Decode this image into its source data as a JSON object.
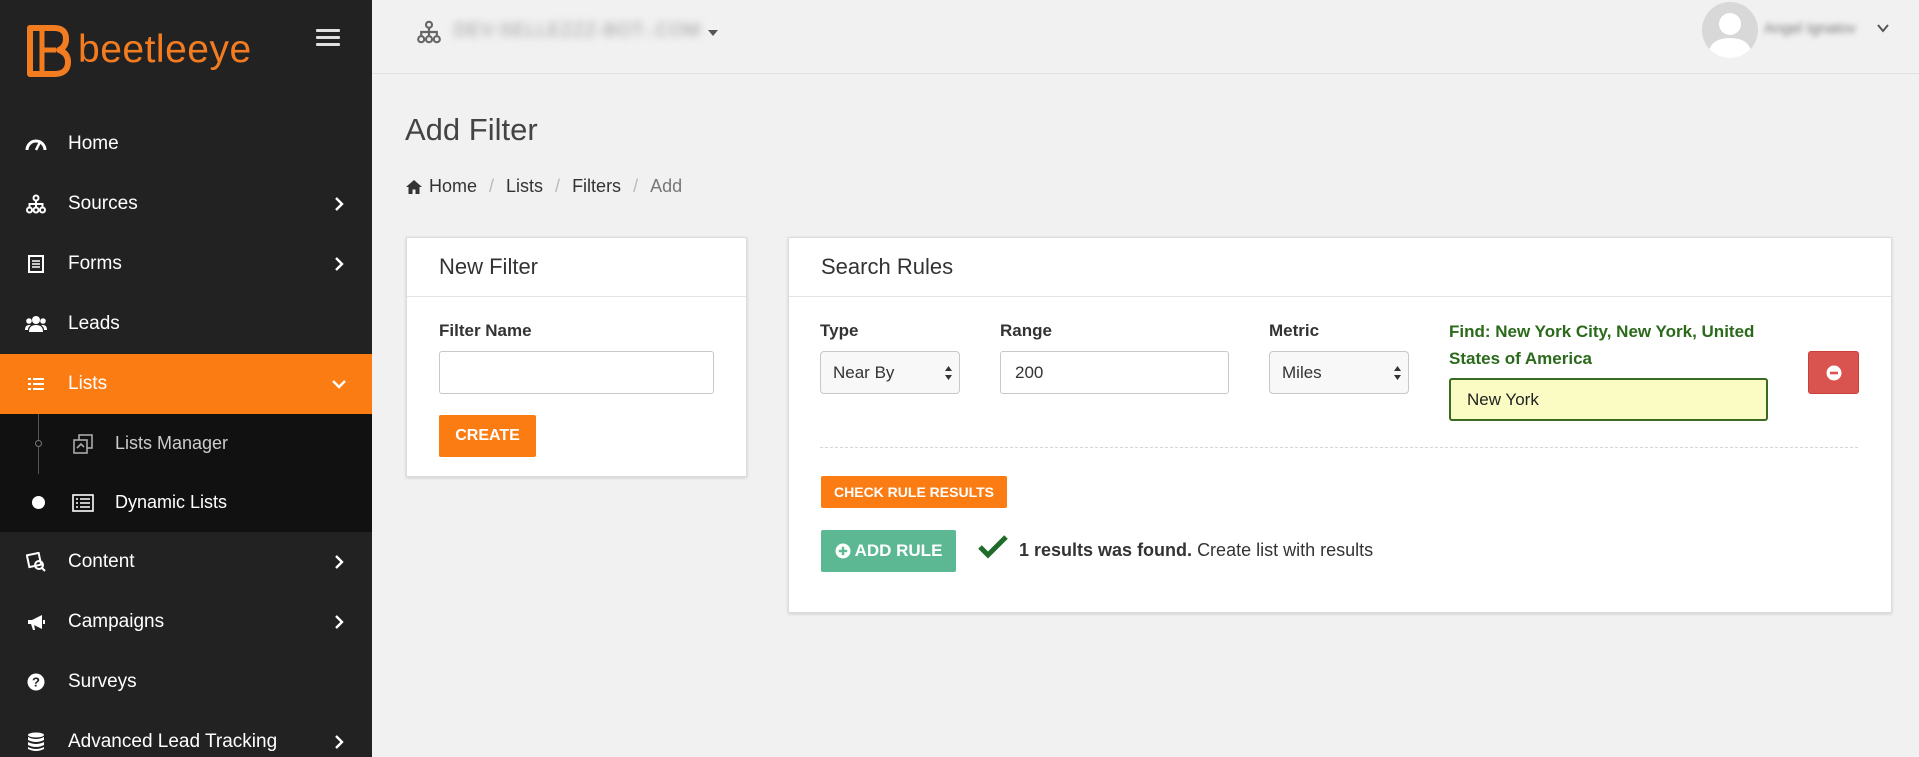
{
  "brand": {
    "name": "beetleeye",
    "color": "#f47c20"
  },
  "sidebar": {
    "items": [
      {
        "label": "Home",
        "icon": "gauge-icon",
        "has_arrow": false
      },
      {
        "label": "Sources",
        "icon": "sitemap-icon",
        "has_arrow": true
      },
      {
        "label": "Forms",
        "icon": "form-icon",
        "has_arrow": true
      },
      {
        "label": "Leads",
        "icon": "users-icon",
        "has_arrow": false
      },
      {
        "label": "Lists",
        "icon": "list-icon",
        "has_arrow": true,
        "active": true
      },
      {
        "label": "Content",
        "icon": "content-icon",
        "has_arrow": true
      },
      {
        "label": "Campaigns",
        "icon": "megaphone-icon",
        "has_arrow": true
      },
      {
        "label": "Surveys",
        "icon": "question-circle-icon",
        "has_arrow": false
      },
      {
        "label": "Advanced Lead Tracking",
        "icon": "database-icon",
        "has_arrow": true
      }
    ],
    "sub_items": [
      {
        "label": "Lists Manager",
        "icon": "copy-icon",
        "active": false
      },
      {
        "label": "Dynamic Lists",
        "icon": "list-alt-icon",
        "active": true
      }
    ]
  },
  "topbar": {
    "org_name": "DEV-SELLEZZZ-BOT-.COM",
    "user_name": "Angel Ignatov"
  },
  "page": {
    "title": "Add Filter",
    "breadcrumb": [
      "Home",
      "Lists",
      "Filters",
      "Add"
    ]
  },
  "new_filter": {
    "title": "New Filter",
    "filter_name_label": "Filter Name",
    "filter_name_value": "",
    "create_button": "CREATE"
  },
  "search_rules": {
    "title": "Search Rules",
    "type_label": "Type",
    "type_value": "Near By",
    "range_label": "Range",
    "range_value": "200",
    "metric_label": "Metric",
    "metric_value": "Miles",
    "find_text": "Find: New York City, New York, United States of America",
    "find_input_value": "New York",
    "check_button": "CHECK RULE RESULTS",
    "add_rule_button": "ADD RULE",
    "result_bold": "1 results was found.",
    "result_rest": "Create list with results"
  },
  "colors": {
    "accent": "#fc7c14",
    "sidebar_bg": "#222222",
    "success_green": "#5cb892",
    "danger_red": "#d9534f",
    "find_text": "#2a6a1a"
  }
}
